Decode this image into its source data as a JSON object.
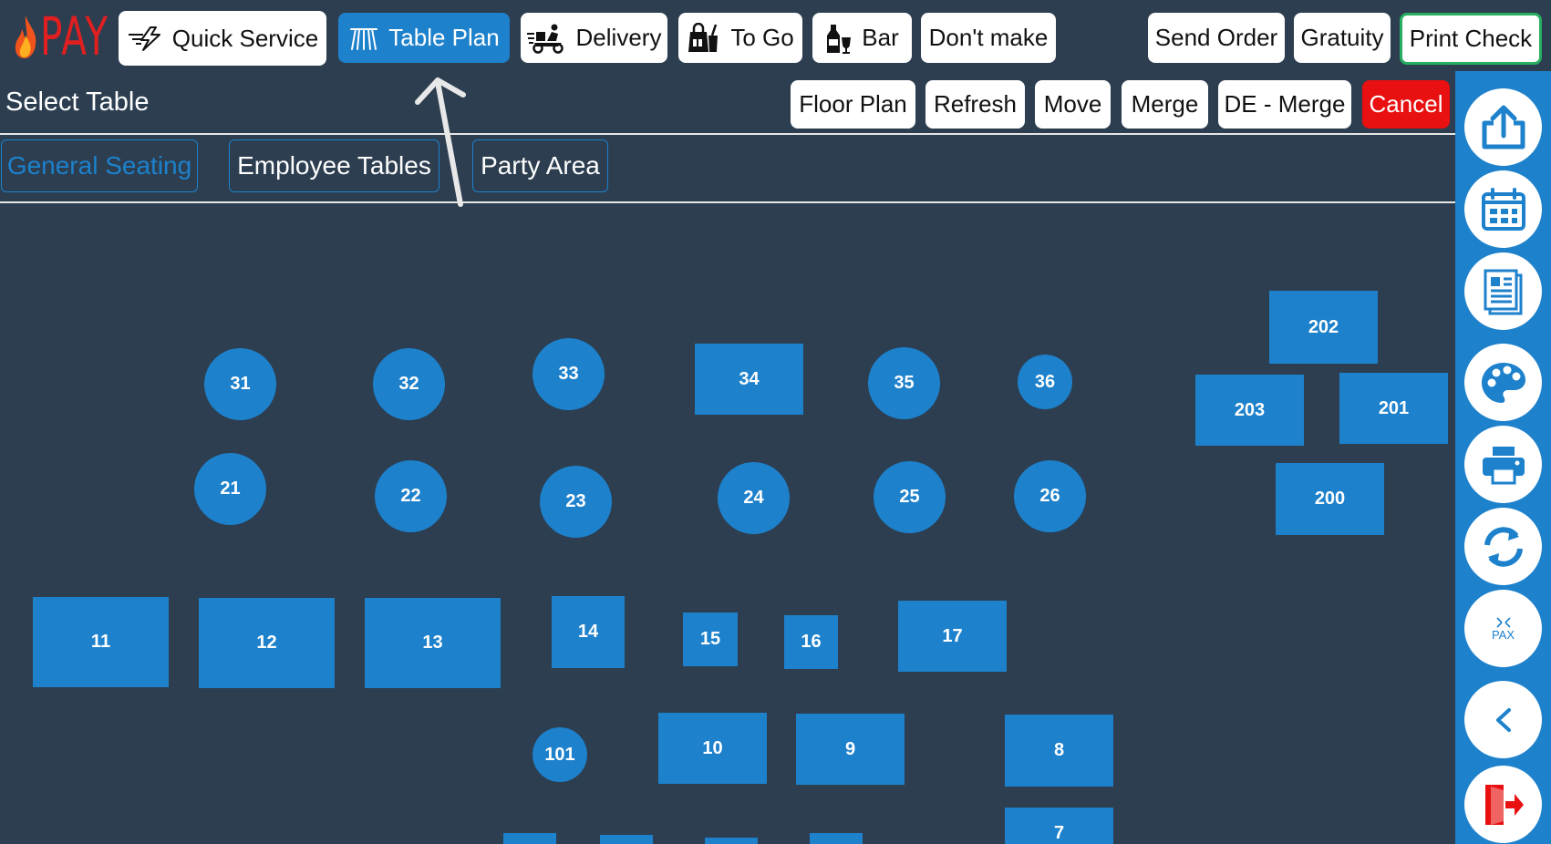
{
  "brand": {
    "name": "PAY"
  },
  "toolbar": {
    "quick_service": "Quick Service",
    "table_plan": "Table Plan",
    "delivery": "Delivery",
    "to_go": "To Go",
    "bar": "Bar",
    "dont_make": "Don't make",
    "send_order": "Send Order",
    "gratuity": "Gratuity",
    "print_check": "Print Check"
  },
  "page_title": "Select Table",
  "actions": {
    "floor_plan": "Floor Plan",
    "refresh": "Refresh",
    "move": "Move",
    "merge": "Merge",
    "de_merge": "DE - Merge",
    "cancel": "Cancel"
  },
  "tabs": [
    "General Seating",
    "Employee Tables",
    "Party Area"
  ],
  "active_tab": "General Seating",
  "sidebar_icons": [
    "upload-icon",
    "calendar-icon",
    "report-icon",
    "palette-icon",
    "printer-icon",
    "sync-icon",
    "pax-icon",
    "back-icon",
    "exit-icon"
  ],
  "pax_label": "PAX",
  "tables": [
    "31",
    "32",
    "33",
    "34",
    "35",
    "36",
    "202",
    "203",
    "201",
    "21",
    "22",
    "23",
    "24",
    "25",
    "26",
    "200",
    "11",
    "12",
    "13",
    "14",
    "15",
    "16",
    "17",
    "101",
    "10",
    "9",
    "8",
    "7"
  ],
  "colors": {
    "background": "#2c3e50",
    "accent": "#1d81cc",
    "cancel": "#e81010",
    "brand": "#e02020",
    "print_check_border": "#27ae60"
  }
}
